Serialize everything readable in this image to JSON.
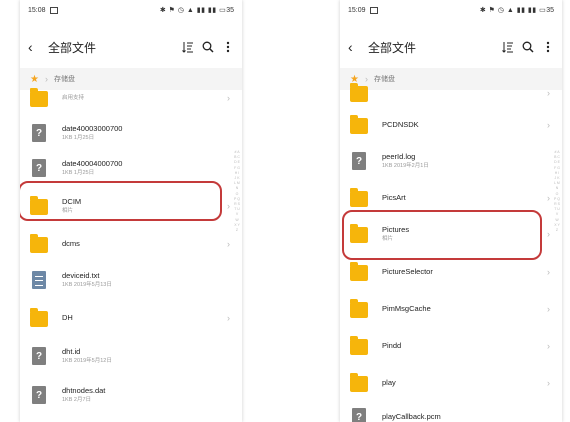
{
  "left": {
    "status": {
      "time": "15:08",
      "battery": "35"
    },
    "title": "全部文件",
    "crumb": "存储盘",
    "items": [
      {
        "name": "",
        "sub": "启用支持",
        "type": "folder"
      },
      {
        "name": "date40003000700",
        "sub": "1KB  1月25日",
        "type": "file"
      },
      {
        "name": "date40004000700",
        "sub": "1KB  1月25日",
        "type": "file"
      },
      {
        "name": "DCIM",
        "sub": "相片",
        "type": "folder"
      },
      {
        "name": "dcms",
        "sub": "",
        "type": "folder"
      },
      {
        "name": "deviceid.txt",
        "sub": "1KB  2019年5月13日",
        "type": "txt"
      },
      {
        "name": "DH",
        "sub": "",
        "type": "folder"
      },
      {
        "name": "dht.id",
        "sub": "1KB  2019年5月12日",
        "type": "file"
      },
      {
        "name": "dhtnodes.dat",
        "sub": "1KB  2月7日",
        "type": "file"
      }
    ]
  },
  "right": {
    "status": {
      "time": "15:09",
      "battery": "35"
    },
    "title": "全部文件",
    "crumb": "存储盘",
    "items": [
      {
        "name": "PCDNSDK",
        "sub": "",
        "type": "folder"
      },
      {
        "name": "peerId.log",
        "sub": "1KB  2019年2月1日",
        "type": "file"
      },
      {
        "name": "PicsArt",
        "sub": "",
        "type": "folder"
      },
      {
        "name": "Pictures",
        "sub": "相片",
        "type": "folder"
      },
      {
        "name": "PictureSelector",
        "sub": "",
        "type": "folder"
      },
      {
        "name": "PimMsgCache",
        "sub": "",
        "type": "folder"
      },
      {
        "name": "Pindd",
        "sub": "",
        "type": "folder"
      },
      {
        "name": "play",
        "sub": "",
        "type": "folder"
      },
      {
        "name": "playCallback.pcm",
        "sub": "",
        "type": "file"
      }
    ]
  },
  "alphabet": "# A B C D E F G H I J K L M N O P Q R S T U V W X Y Z",
  "colors": {
    "folder": "#f6b50b",
    "highlight": "#c43a3a",
    "star": "#f5a623"
  }
}
